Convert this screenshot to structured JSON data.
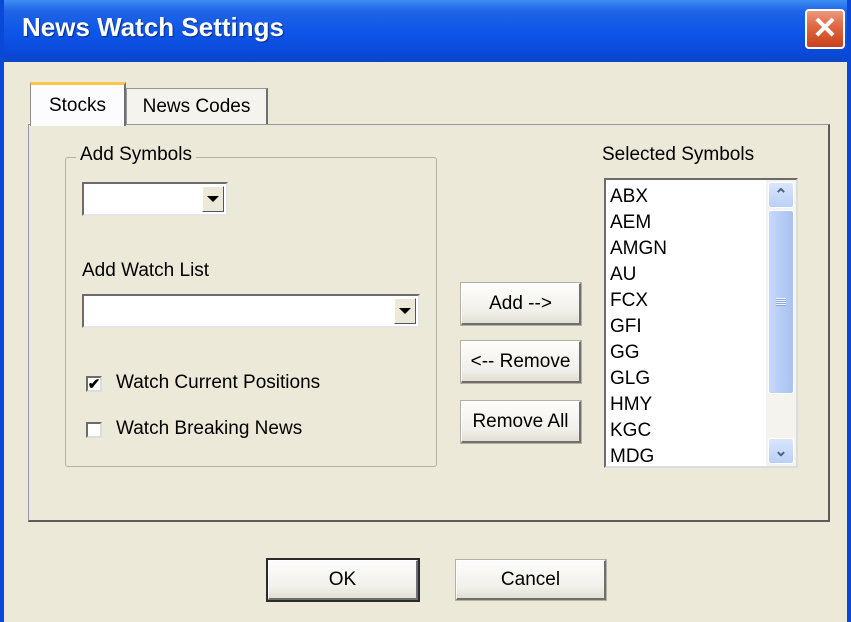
{
  "window": {
    "title": "News Watch Settings",
    "close_glyph": "✕",
    "colors": {
      "titlebar": "#0a4ad8",
      "body": "#ece9d8",
      "close": "#d9552e",
      "tab_highlight": "#fbc54a"
    }
  },
  "tabs": [
    {
      "label": "Stocks",
      "selected": true
    },
    {
      "label": "News Codes",
      "selected": false
    }
  ],
  "stocks_tab": {
    "add_symbols_label": "Add Symbols",
    "add_symbols_value": "",
    "add_watch_list_label": "Add Watch List",
    "add_watch_list_value": "",
    "watch_current_positions": {
      "label": "Watch Current Positions",
      "checked": true,
      "check_glyph": "✔"
    },
    "watch_breaking_news": {
      "label": "Watch Breaking News",
      "checked": false,
      "check_glyph": ""
    },
    "add_button": "Add -->",
    "remove_button": "<-- Remove",
    "remove_all_button": "Remove All",
    "selected_symbols_label": "Selected Symbols",
    "selected_symbols": [
      "ABX",
      "AEM",
      "AMGN",
      "AU",
      "FCX",
      "GFI",
      "GG",
      "GLG",
      "HMY",
      "KGC",
      "MDG"
    ],
    "scroll_up_glyph": "⌃",
    "scroll_down_glyph": "⌄"
  },
  "footer": {
    "ok_button": "OK",
    "cancel_button": "Cancel"
  },
  "icons": [
    "close-icon",
    "dropdown-arrow-icon",
    "checkmark-icon",
    "scroll-up-icon",
    "scroll-down-icon"
  ]
}
